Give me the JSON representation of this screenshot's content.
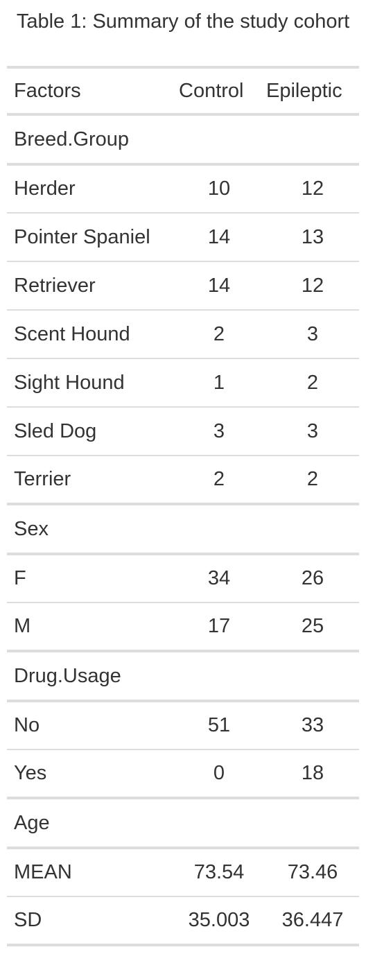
{
  "caption": "Table 1: Summary of the study cohort",
  "table": {
    "headers": [
      "Factors",
      "Control",
      "Epileptic"
    ],
    "rows": [
      {
        "type": "group",
        "label": "Breed.Group"
      },
      {
        "type": "data",
        "label": "Herder",
        "control": "10",
        "epileptic": "12"
      },
      {
        "type": "data",
        "label": "Pointer Spaniel",
        "control": "14",
        "epileptic": "13"
      },
      {
        "type": "data",
        "label": "Retriever",
        "control": "14",
        "epileptic": "12"
      },
      {
        "type": "data",
        "label": "Scent Hound",
        "control": "2",
        "epileptic": "3"
      },
      {
        "type": "data",
        "label": "Sight Hound",
        "control": "1",
        "epileptic": "2"
      },
      {
        "type": "data",
        "label": "Sled Dog",
        "control": "3",
        "epileptic": "3"
      },
      {
        "type": "data",
        "label": "Terrier",
        "control": "2",
        "epileptic": "2"
      },
      {
        "type": "group",
        "label": "Sex"
      },
      {
        "type": "data",
        "label": "F",
        "control": "34",
        "epileptic": "26"
      },
      {
        "type": "data",
        "label": "M",
        "control": "17",
        "epileptic": "25"
      },
      {
        "type": "group",
        "label": "Drug.Usage"
      },
      {
        "type": "data",
        "label": "No",
        "control": "51",
        "epileptic": "33"
      },
      {
        "type": "data",
        "label": "Yes",
        "control": "0",
        "epileptic": "18"
      },
      {
        "type": "group",
        "label": "Age"
      },
      {
        "type": "data",
        "label": "MEAN",
        "control": "73.54",
        "epileptic": "73.46"
      },
      {
        "type": "data",
        "label": "SD",
        "control": "35.003",
        "epileptic": "36.447"
      }
    ]
  }
}
